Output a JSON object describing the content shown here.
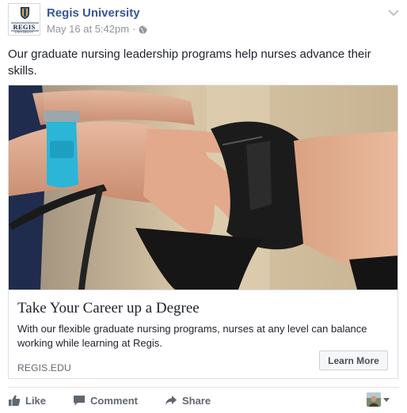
{
  "post": {
    "page_name": "Regis University",
    "timestamp": "May 16 at 5:42pm",
    "separator": "·",
    "privacy_icon": "globe-icon",
    "message": "Our graduate nursing leadership programs help nurses advance their skills."
  },
  "avatar": {
    "logo_text_top": "REGIS",
    "logo_text_bottom": "UNIVERSITY"
  },
  "attachment": {
    "image_alt": "Nurse taking blood pressure with cuff",
    "headline": "Take Your Career up a Degree",
    "description": "With our flexible graduate nursing programs, nurses at any level can balance working while learning at Regis.",
    "domain": "REGIS.EDU",
    "cta_label": "Learn More"
  },
  "actions": {
    "like_label": "Like",
    "comment_label": "Comment",
    "share_label": "Share"
  },
  "colors": {
    "link": "#365899",
    "meta": "#90949c",
    "action": "#616770",
    "border": "#dddfe2"
  }
}
